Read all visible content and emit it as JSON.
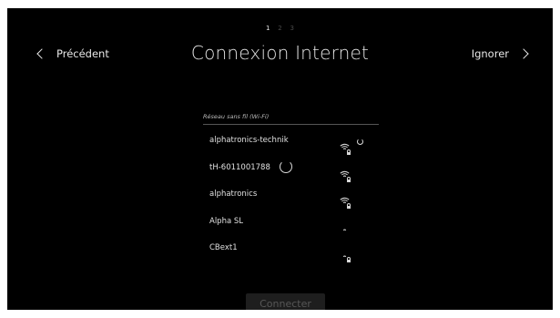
{
  "header": {
    "steps": [
      "1",
      "2",
      "3"
    ],
    "active_step": "1",
    "title": "Connexion Internet",
    "back_label": "Précédent",
    "skip_label": "Ignorer"
  },
  "wifi_section": {
    "label": "Réseau sans fil (Wi-Fi)",
    "networks": [
      {
        "name": "alphatronics-technik",
        "signal": "strong",
        "secured": true,
        "status": "connecting"
      },
      {
        "name": "tH-6011001788",
        "signal": "strong",
        "secured": true,
        "status": "loading"
      },
      {
        "name": "alphatronics",
        "signal": "strong",
        "secured": true,
        "status": ""
      },
      {
        "name": "Alpha SL",
        "signal": "weak",
        "secured": false,
        "status": ""
      },
      {
        "name": "CBext1",
        "signal": "weak",
        "secured": true,
        "status": ""
      }
    ]
  },
  "footer": {
    "connect_label": "Connecter",
    "connect_enabled": false
  },
  "colors": {
    "background": "#000000",
    "text": "#e6e6e6",
    "step_inactive": "#4a4a4a",
    "button_disabled_bg": "#1e1e1e",
    "button_disabled_text": "#575757"
  }
}
